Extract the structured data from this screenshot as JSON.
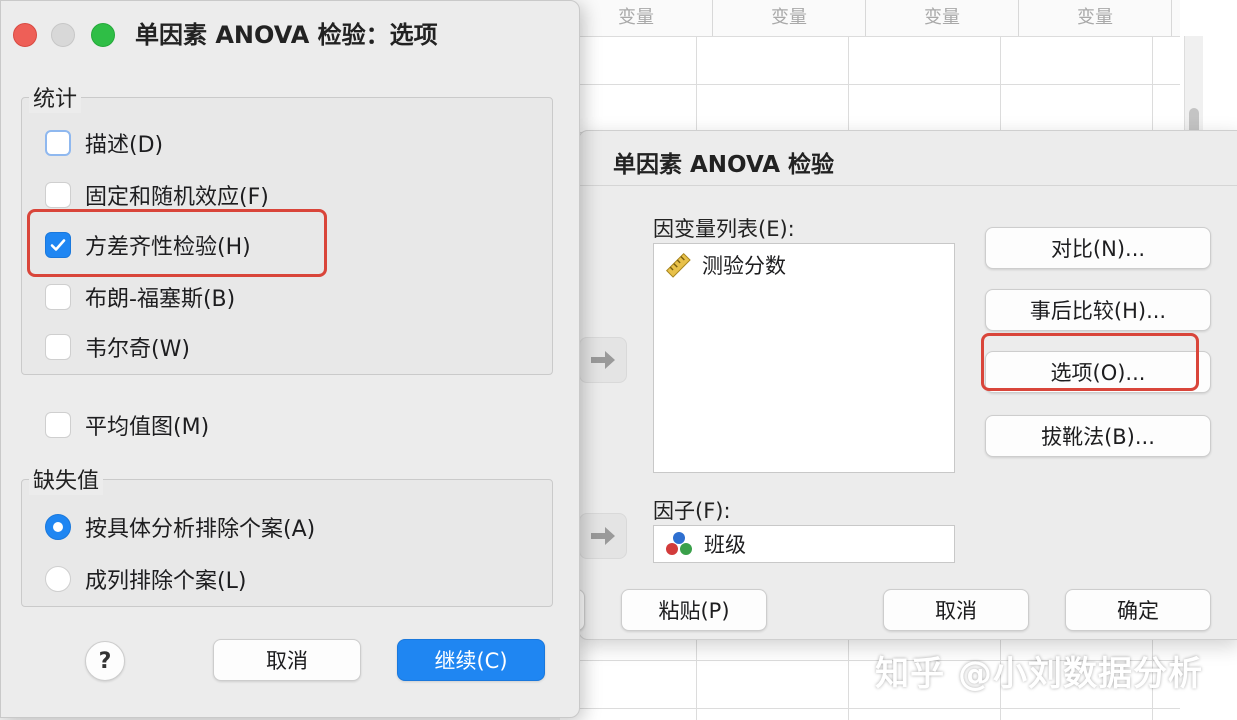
{
  "sheet": {
    "columns": [
      "变量",
      "变量",
      "变量",
      "变量"
    ]
  },
  "main_dialog": {
    "title": "单因素 ANOVA 检验",
    "dependent_label": "因变量列表(E):",
    "dependent_items": [
      {
        "label": "测验分数",
        "icon": "ruler-icon"
      }
    ],
    "factor_label": "因子(F):",
    "factor_item": {
      "label": "班级",
      "icon": "nominal-icon"
    },
    "buttons": {
      "contrasts": "对比(N)...",
      "post_hoc": "事后比较(H)...",
      "options": "选项(O)...",
      "bootstrap": "拔靴法(B)...",
      "paste": "粘贴(P)",
      "cancel": "取消",
      "ok": "确定"
    }
  },
  "options_dialog": {
    "title": "单因素 ANOVA 检验：选项",
    "statistics_legend": "统计",
    "statistics": [
      {
        "label": "描述(D)",
        "checked": false
      },
      {
        "label": "固定和随机效应(F)",
        "checked": false
      },
      {
        "label": "方差齐性检验(H)",
        "checked": true
      },
      {
        "label": "布朗-福塞斯(B)",
        "checked": false
      },
      {
        "label": "韦尔奇(W)",
        "checked": false
      }
    ],
    "means_plot": {
      "label": "平均值图(M)",
      "checked": false
    },
    "missing_legend": "缺失值",
    "missing": [
      {
        "label": "按具体分析排除个案(A)",
        "selected": true
      },
      {
        "label": "成列排除个案(L)",
        "selected": false
      }
    ],
    "help": "?",
    "cancel": "取消",
    "continue": "继续(C)"
  },
  "watermark": "知乎 @小刘数据分析",
  "colors": {
    "accent": "#1f86f2",
    "highlight": "#d9453a"
  }
}
